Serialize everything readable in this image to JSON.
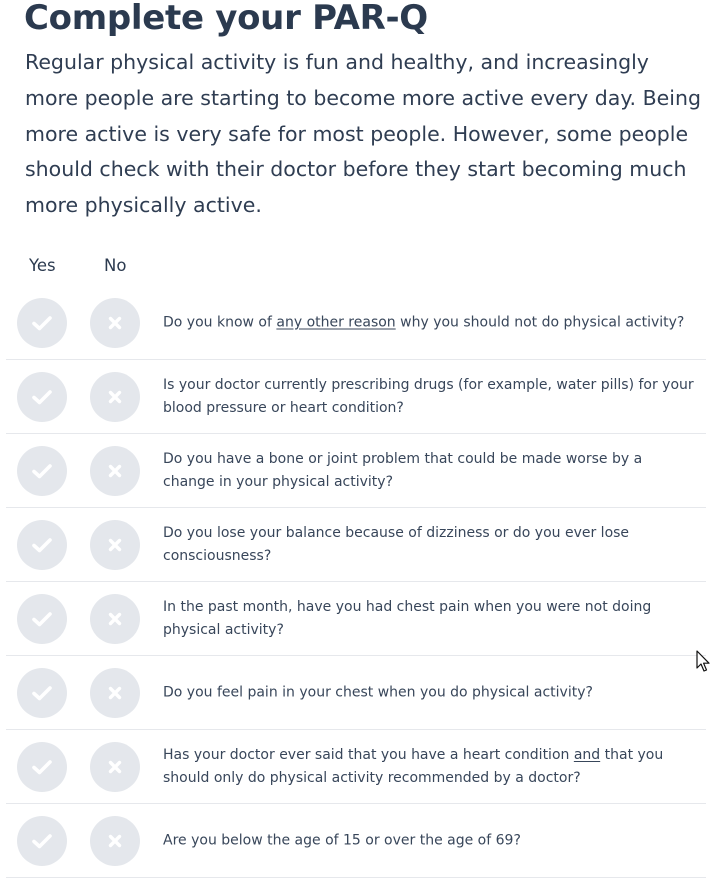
{
  "page": {
    "title": "Complete your PAR-Q",
    "intro": "Regular physical activity is fun and healthy, and increasingly more people are starting to become more active every day. Being more active is very safe for most people. However, some people should check with their doctor before they start becoming much more physically active."
  },
  "columns": {
    "yes": "Yes",
    "no": "No"
  },
  "icons": {
    "yes": "check-icon",
    "no": "x-icon",
    "pointer": "mouse-cursor-icon"
  },
  "colors": {
    "circle_bg": "#e4e7ec",
    "icon": "#ffffff",
    "text": "#2b3a4f"
  },
  "questions": [
    {
      "pre": "Do you know of ",
      "em": "any other reason",
      "post": " why you should not do physical activity?"
    },
    {
      "pre": "Is your doctor currently prescribing drugs (for example, water pills) for your blood pressure or heart condition?",
      "em": "",
      "post": ""
    },
    {
      "pre": "Do you have a bone or joint problem that could be made worse by a change in your physical activity?",
      "em": "",
      "post": ""
    },
    {
      "pre": "Do you lose your balance because of dizziness or do you ever lose consciousness?",
      "em": "",
      "post": ""
    },
    {
      "pre": "In the past month, have you had chest pain when you were not doing physical activity?",
      "em": "",
      "post": ""
    },
    {
      "pre": "Do you feel pain in your chest when you do physical activity?",
      "em": "",
      "post": ""
    },
    {
      "pre": "Has your doctor ever said that you have a heart condition ",
      "em": "and",
      "post": " that you should only do physical activity recommended by a doctor?"
    },
    {
      "pre": "Are you below the age of 15 or over the age of 69?",
      "em": "",
      "post": ""
    }
  ]
}
